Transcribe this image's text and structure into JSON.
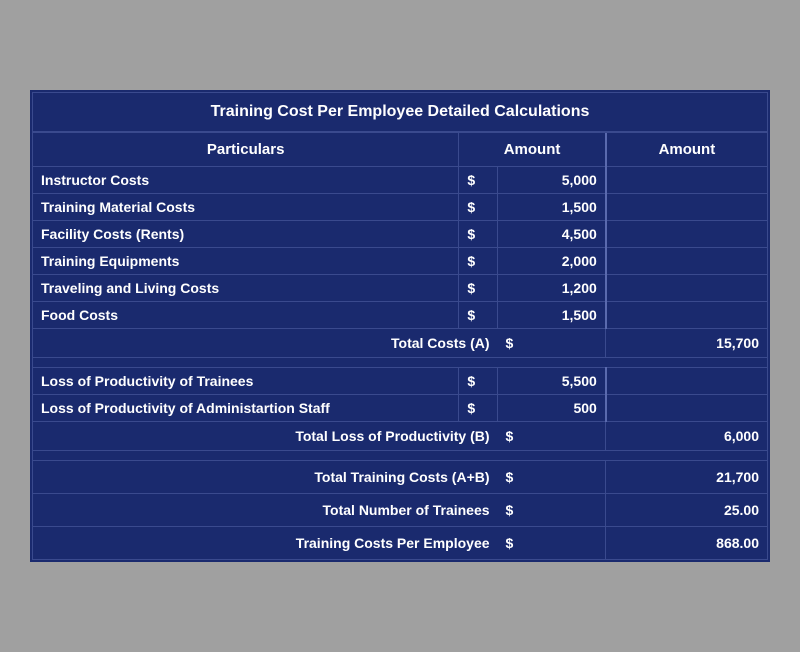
{
  "table": {
    "title": "Training Cost Per Employee Detailed Calculations",
    "headers": {
      "particulars": "Particulars",
      "amount1": "Amount",
      "amount2": "Amount"
    },
    "section1": {
      "rows": [
        {
          "label": "Instructor Costs",
          "dollar": "$",
          "value": "5,000"
        },
        {
          "label": "Training Material Costs",
          "dollar": "$",
          "value": "1,500"
        },
        {
          "label": "Facility Costs (Rents)",
          "dollar": "$",
          "value": "4,500"
        },
        {
          "label": "Training Equipments",
          "dollar": "$",
          "value": "2,000"
        },
        {
          "label": "Traveling and Living Costs",
          "dollar": "$",
          "value": "1,200"
        },
        {
          "label": "Food Costs",
          "dollar": "$",
          "value": "1,500"
        }
      ],
      "subtotal_label": "Total Costs (A)",
      "subtotal_dollar": "$",
      "subtotal_value": "15,700"
    },
    "section2": {
      "rows": [
        {
          "label": "Loss of Productivity of Trainees",
          "dollar": "$",
          "value": "5,500"
        },
        {
          "label": "Loss of Productivity of Administartion Staff",
          "dollar": "$",
          "value": "500"
        }
      ],
      "subtotal_label": "Total Loss of Productivity (B)",
      "subtotal_dollar": "$",
      "subtotal_value": "6,000"
    },
    "totals": [
      {
        "label": "Total Training Costs (A+B)",
        "dollar": "$",
        "value": "21,700"
      },
      {
        "label": "Total Number of Trainees",
        "dollar": "$",
        "value": "25.00"
      },
      {
        "label": "Training Costs Per Employee",
        "dollar": "$",
        "value": "868.00"
      }
    ]
  }
}
